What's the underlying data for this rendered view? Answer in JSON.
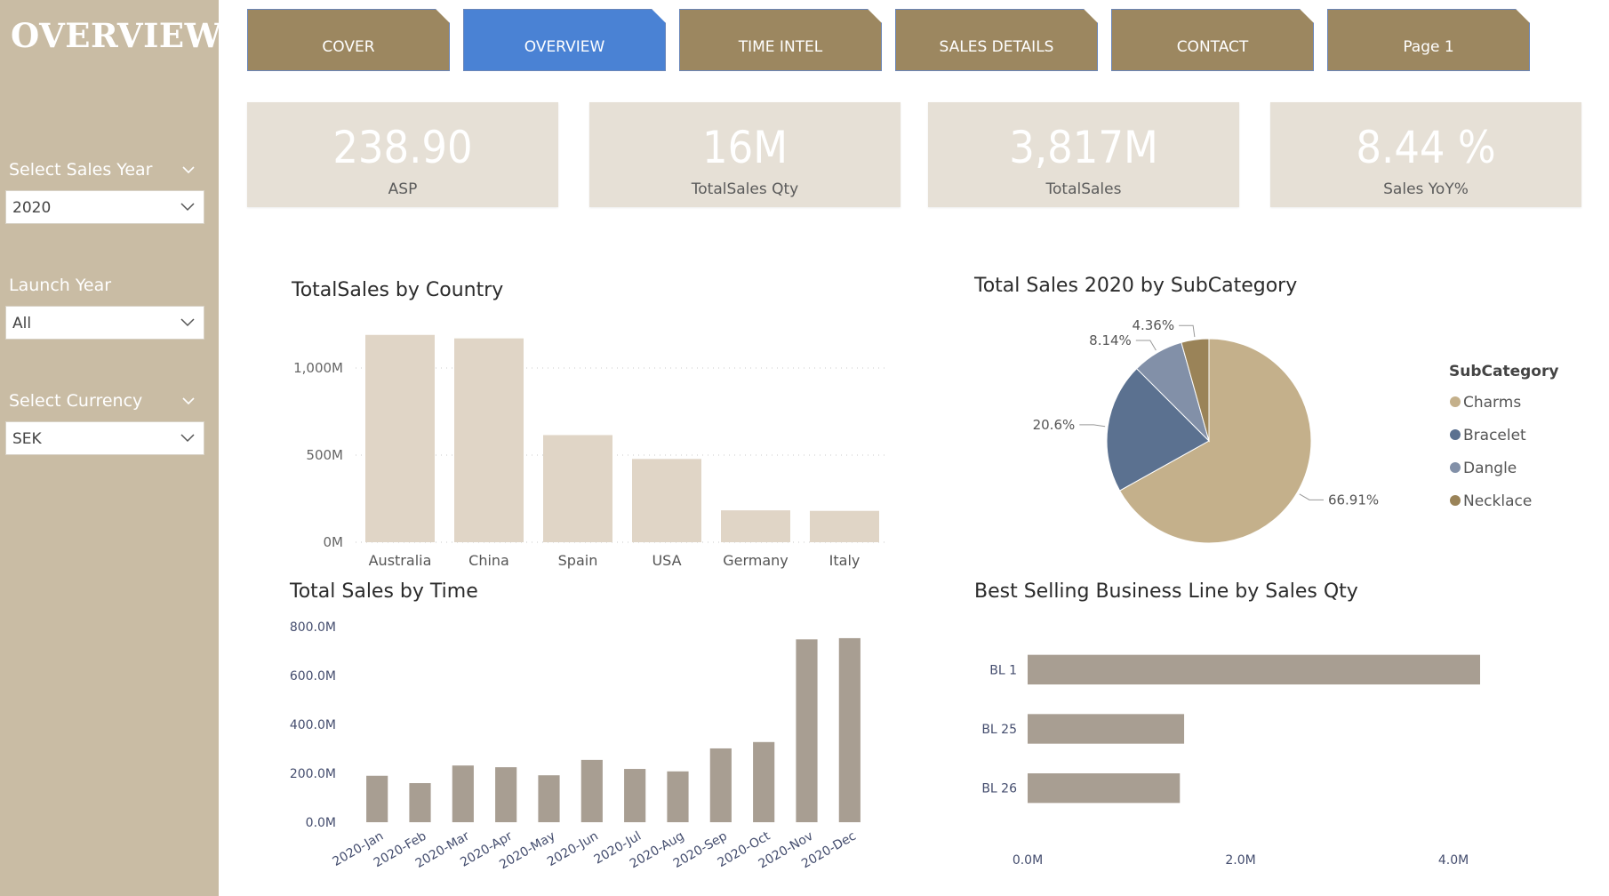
{
  "sidebar": {
    "title": "OVERVIEW",
    "slicers": [
      {
        "label": "Select Sales Year",
        "value": "2020"
      },
      {
        "label": "Launch Year",
        "value": "All"
      },
      {
        "label": "Select Currency",
        "value": "SEK"
      }
    ]
  },
  "tabs": [
    {
      "label": "COVER",
      "active": false
    },
    {
      "label": "OVERVIEW",
      "active": true
    },
    {
      "label": "TIME INTEL",
      "active": false
    },
    {
      "label": "SALES DETAILS",
      "active": false
    },
    {
      "label": "CONTACT",
      "active": false
    },
    {
      "label": "Page 1",
      "active": false
    }
  ],
  "kpis": [
    {
      "value": "238.90",
      "label": "ASP"
    },
    {
      "value": "16M",
      "label": "TotalSales Qty"
    },
    {
      "value": "3,817M",
      "label": "TotalSales"
    },
    {
      "value": "8.44 %",
      "label": "Sales YoY%"
    }
  ],
  "colors": {
    "sidebar": "#c9bca4",
    "tab": "#9c8760",
    "tab_active": "#4a82d4",
    "kpi_bg": "#e6e0d6",
    "country_bar": "#e0d5c6",
    "time_bar": "#a89e92",
    "bl_bar": "#a89e92"
  },
  "chart_data": [
    {
      "type": "bar",
      "title": "TotalSales by Country",
      "categories": [
        "Australia",
        "China",
        "Spain",
        "USA",
        "Germany",
        "Italy"
      ],
      "values": [
        1190,
        1170,
        615,
        478,
        183,
        180
      ],
      "yticks": [
        "0M",
        "500M",
        "1,000M"
      ],
      "ylim": [
        0,
        1250
      ],
      "grid": true
    },
    {
      "type": "pie",
      "title": "Total Sales 2020 by SubCategory",
      "legend_title": "SubCategory",
      "legend_position": "right",
      "slices": [
        {
          "name": "Charms",
          "value": 66.91,
          "label": "66.91%",
          "color": "#c4b08b"
        },
        {
          "name": "Bracelet",
          "value": 20.6,
          "label": "20.6%",
          "color": "#5b7190"
        },
        {
          "name": "Dangle",
          "value": 8.14,
          "label": "8.14%",
          "color": "#8290a8"
        },
        {
          "name": "Necklace",
          "value": 4.36,
          "label": "4.36%",
          "color": "#9a8358"
        }
      ]
    },
    {
      "type": "bar",
      "title": "Total Sales by Time",
      "categories": [
        "2020-Jan",
        "2020-Feb",
        "2020-Mar",
        "2020-Apr",
        "2020-May",
        "2020-Jun",
        "2020-Jul",
        "2020-Aug",
        "2020-Sep",
        "2020-Oct",
        "2020-Nov",
        "2020-Dec"
      ],
      "values": [
        190,
        160,
        232,
        225,
        192,
        255,
        218,
        208,
        302,
        328,
        748,
        753
      ],
      "yticks": [
        "0.0M",
        "200.0M",
        "400.0M",
        "600.0M",
        "800.0M"
      ],
      "ylim": [
        0,
        800
      ]
    },
    {
      "type": "bar",
      "orientation": "horizontal",
      "title": "Best Selling Business Line by Sales Qty",
      "categories": [
        "BL 1",
        "BL 25",
        "BL 26"
      ],
      "values": [
        4.25,
        1.47,
        1.43
      ],
      "xticks": [
        "0.0M",
        "2.0M",
        "4.0M"
      ],
      "xlim": [
        0,
        4.25
      ]
    }
  ]
}
